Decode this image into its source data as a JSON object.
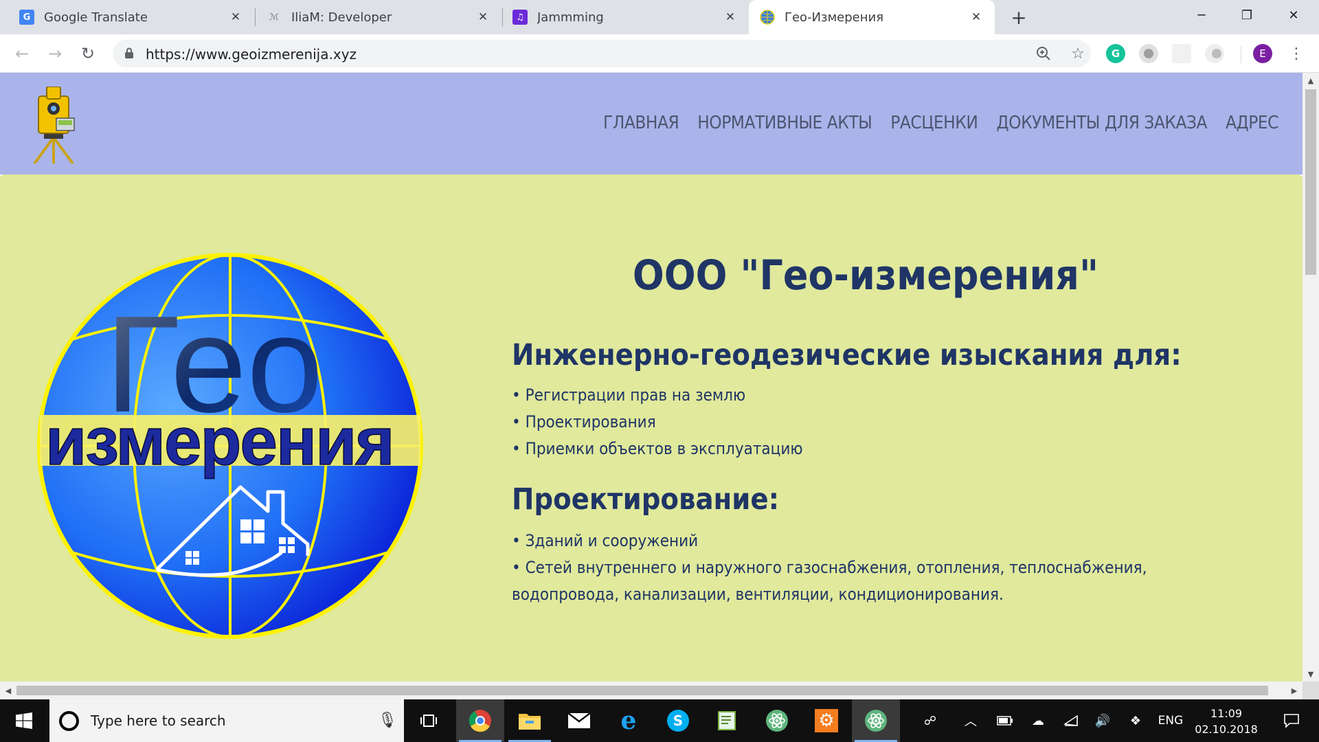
{
  "browser": {
    "tabs": [
      {
        "title": "Google Translate",
        "icon": "google-translate-icon",
        "icon_color": "#4285f4"
      },
      {
        "title": "IliaM: Developer",
        "icon": "signature-icon",
        "icon_color": "#9e9e9e"
      },
      {
        "title": "Jammming",
        "icon": "jammming-icon",
        "icon_color": "#6c2bd9"
      },
      {
        "title": "Гео-Измерения",
        "icon": "globe-icon",
        "icon_color": "#3d7fd6",
        "active": true
      }
    ],
    "url": "https://www.geoizmerenija.xyz",
    "profile_initial": "E",
    "profile_color": "#7b1fa2",
    "grammarly_letter": "G"
  },
  "site": {
    "nav": [
      "ГЛАВНАЯ",
      "НОРМАТИВНЫЕ АКТЫ",
      "РАСЦЕНКИ",
      "ДОКУМЕНТЫ ДЛЯ ЗАКАЗА",
      "АДРЕС"
    ],
    "logo": {
      "word1": "Гео",
      "word2": "измерения"
    },
    "company_name": "ООО \"Гео-измерения\"",
    "sections": [
      {
        "heading": "Инженерно-геодезические изыскания для:",
        "items": [
          "• Регистрации прав на землю",
          "• Проектирования",
          "• Приемки объектов в эксплуатацию"
        ]
      },
      {
        "heading": "Проектирование:",
        "items": [
          "• Зданий и сооружений",
          "• Сетей внутреннего и наружного газоснабжения, отопления, теплоснабжения, водопровода, канализации, вентиляции, кондиционирования."
        ]
      }
    ],
    "colors": {
      "header_bg": "#aab4ea",
      "content_bg": "#e0e99c",
      "text": "#1f3566"
    }
  },
  "taskbar": {
    "search_placeholder": "Type here to search",
    "language": "ENG",
    "time": "11:09",
    "date": "02.10.2018"
  }
}
